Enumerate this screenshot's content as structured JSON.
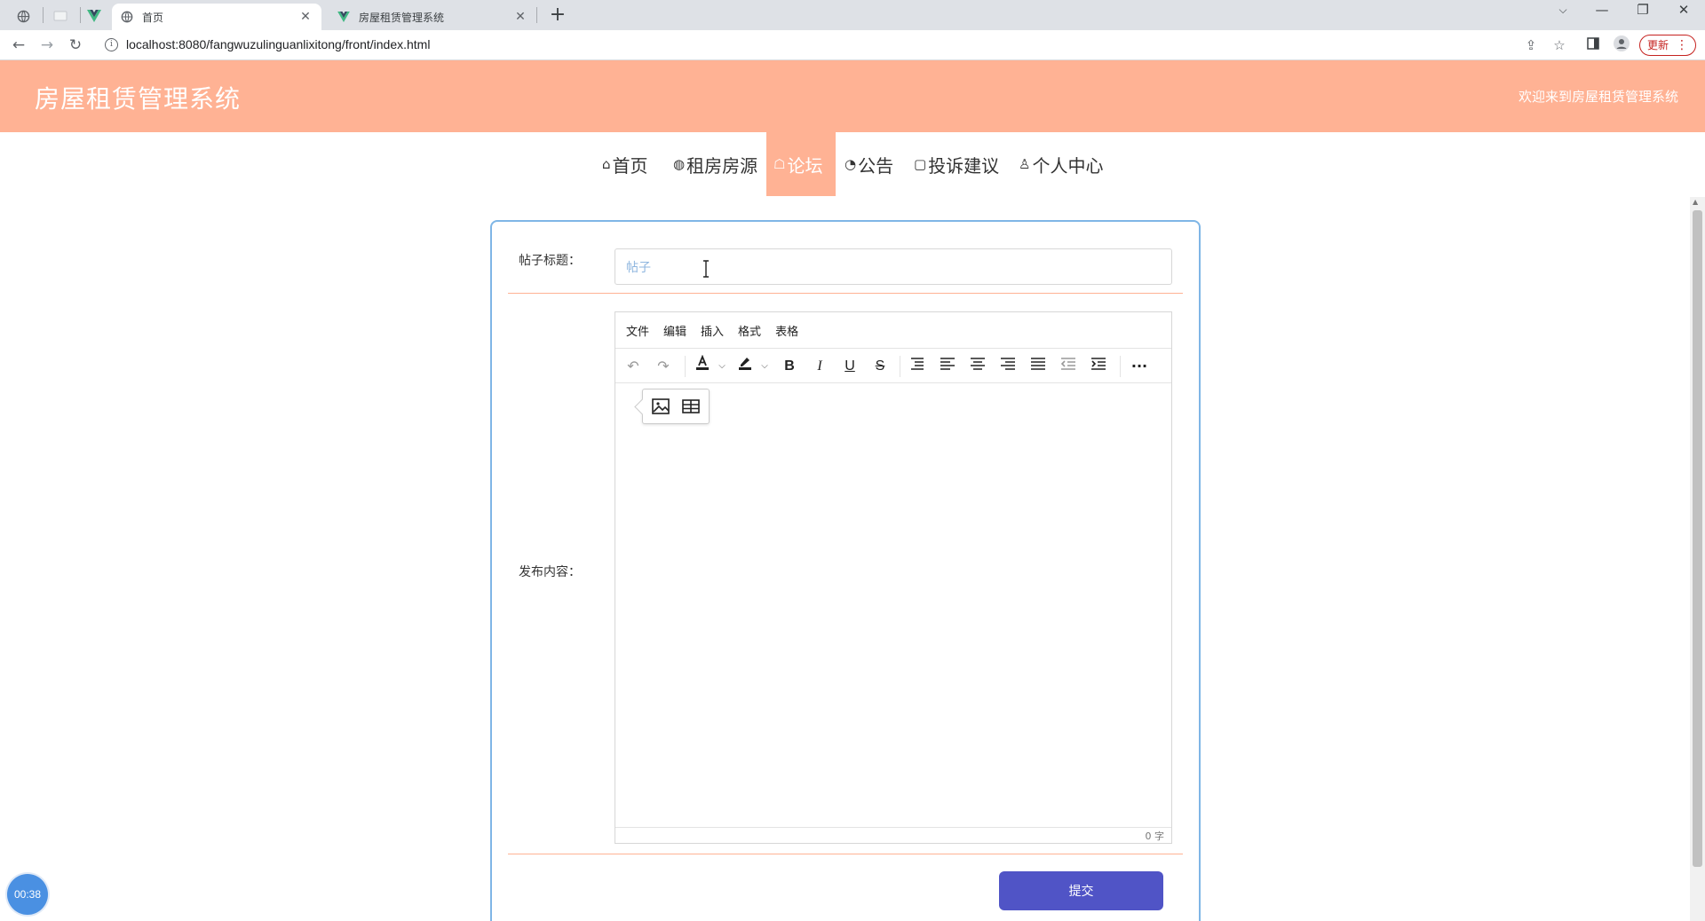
{
  "browser": {
    "tabs": [
      {
        "title": "首页",
        "active": true
      },
      {
        "title": "房屋租赁管理系统",
        "active": false
      }
    ],
    "new_tab": "+",
    "url": "localhost:8080/fangwuzulinguanlixitong/front/index.html",
    "update_label": "更新"
  },
  "header": {
    "title": "房屋租赁管理系统",
    "welcome": "欢迎来到房屋租赁管理系统"
  },
  "nav": {
    "items": [
      {
        "label": "首页",
        "icon": "home-icon"
      },
      {
        "label": "租房房源",
        "icon": "globe-icon"
      },
      {
        "label": "论坛",
        "icon": "chat-icon",
        "active": true
      },
      {
        "label": "公告",
        "icon": "palette-icon"
      },
      {
        "label": "投诉建议",
        "icon": "note-icon"
      },
      {
        "label": "个人中心",
        "icon": "user-icon"
      }
    ]
  },
  "form": {
    "title_label": "帖子标题：",
    "title_value": "帖子",
    "content_label": "发布内容：",
    "submit_label": "提交"
  },
  "editor": {
    "menus": [
      "文件",
      "编辑",
      "插入",
      "格式",
      "表格"
    ],
    "word_count": "0 字"
  },
  "timer": "00:38",
  "colors": {
    "header_bg": "#ffb294",
    "card_border": "#7fb6e6",
    "submit_bg": "#5054c6"
  }
}
